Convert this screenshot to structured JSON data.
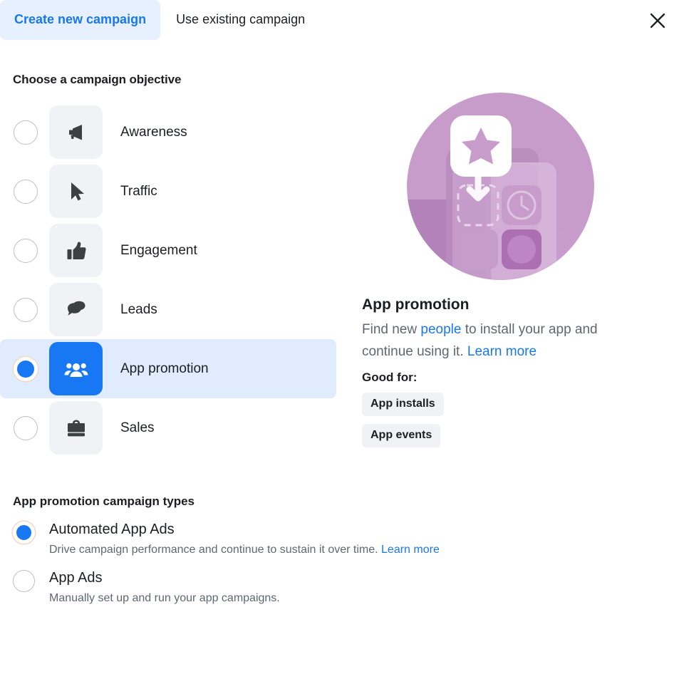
{
  "header": {
    "tabs": [
      {
        "label": "Create new campaign",
        "active": true
      },
      {
        "label": "Use existing campaign",
        "active": false
      }
    ],
    "close_icon": "close-icon"
  },
  "objective_section": {
    "title": "Choose a campaign objective",
    "items": [
      {
        "label": "Awareness",
        "icon": "megaphone-icon",
        "selected": false
      },
      {
        "label": "Traffic",
        "icon": "cursor-icon",
        "selected": false
      },
      {
        "label": "Engagement",
        "icon": "thumbs-up-icon",
        "selected": false
      },
      {
        "label": "Leads",
        "icon": "chat-bubble-icon",
        "selected": false
      },
      {
        "label": "App promotion",
        "icon": "people-icon",
        "selected": true
      },
      {
        "label": "Sales",
        "icon": "briefcase-icon",
        "selected": false
      }
    ]
  },
  "detail": {
    "illustration": "app-promotion-illustration",
    "title": "App promotion",
    "desc_part1": "Find new ",
    "desc_link1": "people",
    "desc_part2": " to install your app and continue using it. ",
    "desc_link2": "Learn more",
    "good_for_label": "Good for:",
    "badges": [
      "App installs",
      "App events"
    ]
  },
  "campaign_types": {
    "title": "App promotion campaign types",
    "options": [
      {
        "label": "Automated App Ads",
        "desc": "Drive campaign performance and continue to sustain it over time. ",
        "link": "Learn more",
        "selected": true
      },
      {
        "label": "App Ads",
        "desc": "Manually set up and run your app campaigns.",
        "link": "",
        "selected": false
      }
    ]
  },
  "colors": {
    "accent": "#1877f2",
    "tab_active_bg": "#e7f0fe",
    "row_selected_bg": "#e0ecfd",
    "tile_bg": "#f0f2f5",
    "text": "#1c1e21",
    "muted": "#606770",
    "illustration_purple": "#bf8ec4"
  }
}
